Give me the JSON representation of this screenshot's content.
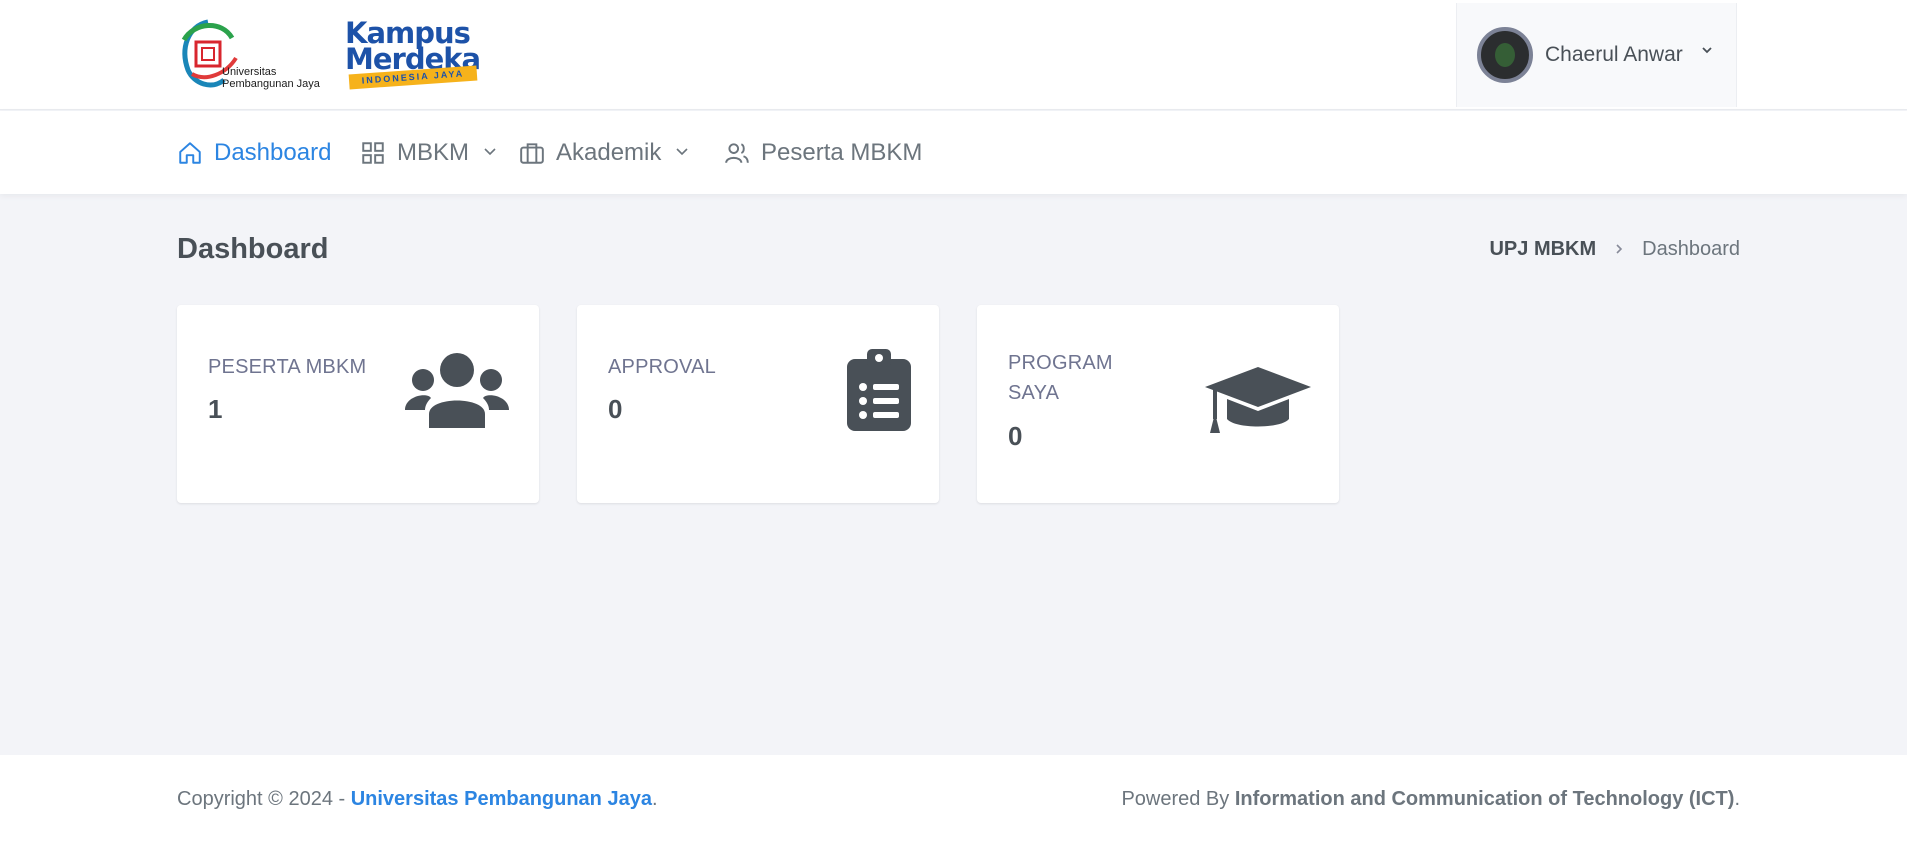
{
  "header": {
    "logo_upj_text_line1": "Universitas",
    "logo_upj_text_line2": "Pembangunan Jaya",
    "logo_km_line1": "Kampus",
    "logo_km_line2": "Merdeka",
    "logo_km_band": "INDONESIA JAYA",
    "user_name": "Chaerul Anwar"
  },
  "nav": {
    "items": [
      {
        "label": "Dashboard",
        "icon": "home-icon",
        "active": true
      },
      {
        "label": "MBKM",
        "icon": "grid-icon",
        "dropdown": true
      },
      {
        "label": "Akademik",
        "icon": "briefcase-icon",
        "dropdown": true
      },
      {
        "label": "Peserta MBKM",
        "icon": "users-icon"
      }
    ],
    "active_color": "#2c85e2"
  },
  "page": {
    "title": "Dashboard",
    "breadcrumb_root": "UPJ MBKM",
    "breadcrumb_current": "Dashboard"
  },
  "cards": [
    {
      "label": "PESERTA MBKM",
      "value": "1",
      "icon": "users-icon"
    },
    {
      "label": "APPROVAL",
      "value": "0",
      "icon": "clipboard-list-icon"
    },
    {
      "label_line1": "PROGRAM",
      "label_line2": "SAYA",
      "value": "0",
      "icon": "graduation-cap-icon"
    }
  ],
  "footer": {
    "copyright_prefix": "Copyright © 2024 - ",
    "copyright_link": "Universitas Pembangunan Jaya",
    "copyright_suffix": ".",
    "powered_prefix": "Powered By ",
    "powered_strong": "Information and Communication of Technology (ICT)",
    "powered_suffix": "."
  },
  "colors": {
    "background": "#f3f4f8",
    "card_icon": "#495057",
    "brand_blue": "#1d52a8",
    "brand_yellow": "#f6b21b"
  }
}
